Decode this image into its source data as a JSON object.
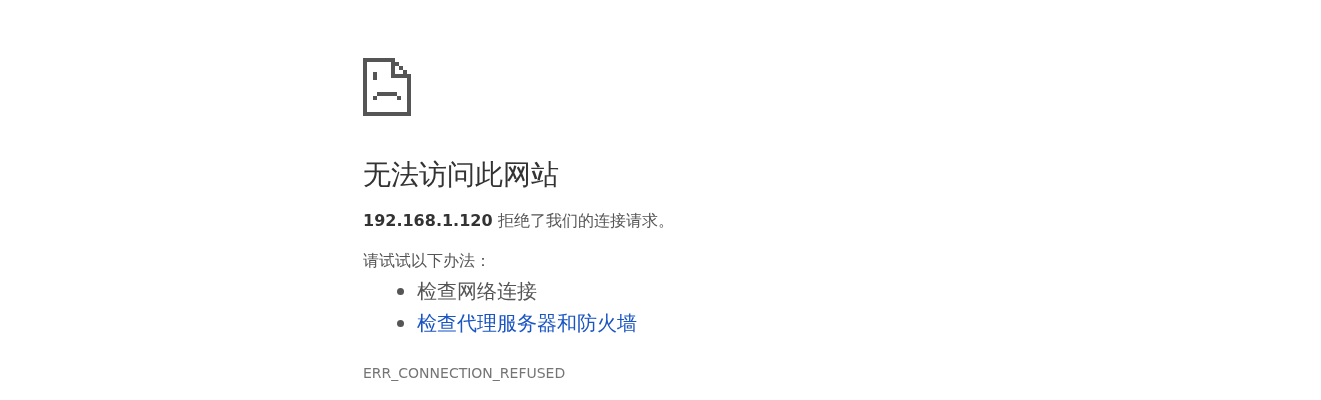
{
  "heading": "无法访问此网站",
  "summary": {
    "host": "192.168.1.120",
    "message": "拒绝了我们的连接请求。"
  },
  "suggestions_label": "请试试以下办法：",
  "suggestions": [
    {
      "kind": "text",
      "label": "检查网络连接"
    },
    {
      "kind": "link",
      "label": "检查代理服务器和防火墙"
    }
  ],
  "error_code": "ERR_CONNECTION_REFUSED"
}
